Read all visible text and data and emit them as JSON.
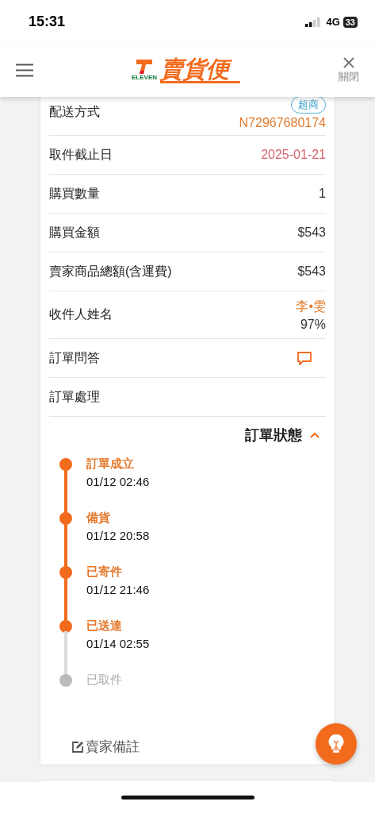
{
  "status_bar": {
    "time": "15:31",
    "network": "4G",
    "battery": "33"
  },
  "header": {
    "logo_mark": "ELEVEN",
    "logo_text": "賣貨便",
    "close_label": "關閉"
  },
  "details": [
    {
      "kind": "shipping",
      "label": "配送方式",
      "badge": "超商",
      "value": "N72967680174"
    },
    {
      "kind": "date",
      "label": "取件截止日",
      "value": "2025-01-21"
    },
    {
      "kind": "plain",
      "label": "購買數量",
      "value": "1"
    },
    {
      "kind": "plain",
      "label": "購買金額",
      "value": "$543"
    },
    {
      "kind": "plain",
      "label": "賣家商品總額(含運費)",
      "value": "$543"
    },
    {
      "kind": "recipient",
      "label": "收件人姓名",
      "value": "李•雯",
      "sub": "97%"
    },
    {
      "kind": "chat",
      "label": "訂單問答"
    },
    {
      "kind": "plain",
      "label": "訂單處理"
    }
  ],
  "order_status": {
    "title": "訂單狀態",
    "expanded": true,
    "steps": [
      {
        "label": "訂單成立",
        "time": "01/12 02:46",
        "done": true
      },
      {
        "label": "備貨",
        "time": "01/12 20:58",
        "done": true
      },
      {
        "label": "已寄件",
        "time": "01/12 21:46",
        "done": true
      },
      {
        "label": "已送達",
        "time": "01/14 02:55",
        "done": true
      },
      {
        "label": "已取件",
        "done": false
      }
    ]
  },
  "seller_note": "賣家備註"
}
